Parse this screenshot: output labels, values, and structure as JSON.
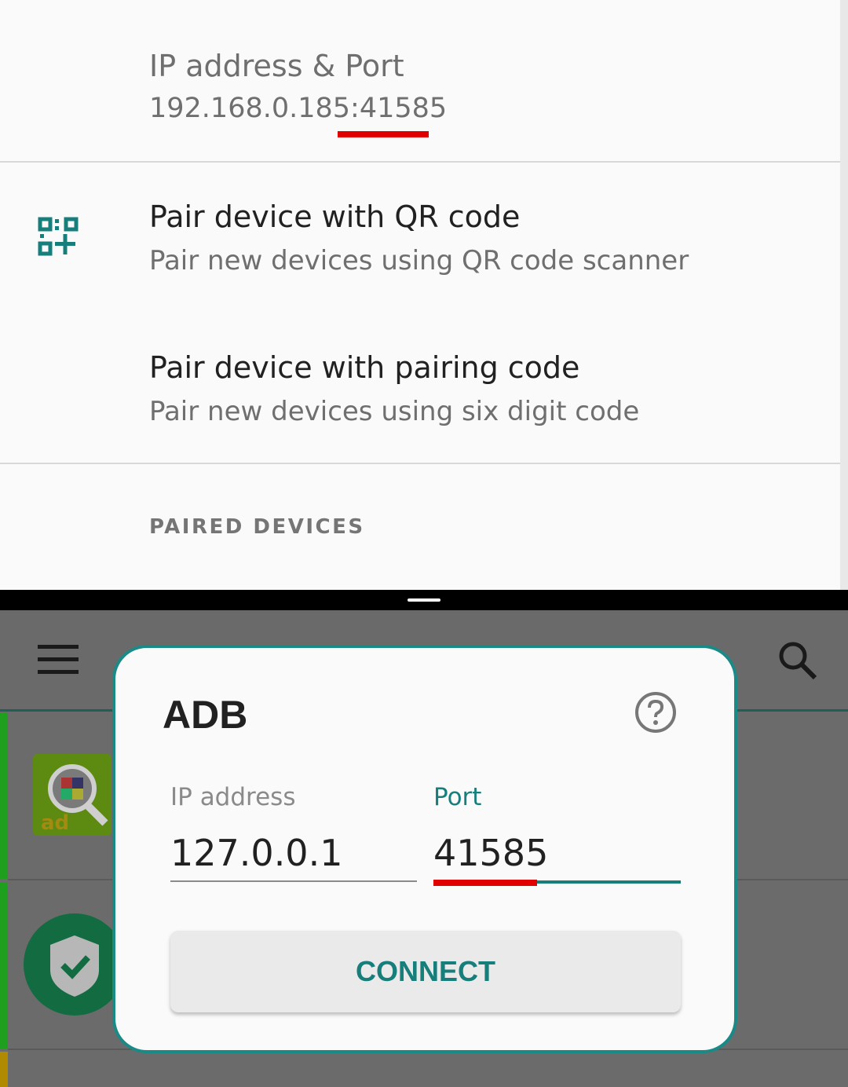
{
  "settings": {
    "ip_port_title": "IP address & Port",
    "ip_port_value": "192.168.0.185:41585",
    "pair_qr_title": "Pair device with QR code",
    "pair_qr_sub": "Pair new devices using QR code scanner",
    "pair_code_title": "Pair device with pairing code",
    "pair_code_sub": "Pair new devices using six digit code",
    "paired_header": "PAIRED DEVICES"
  },
  "app": {
    "menu_icon": "hamburger-menu-icon",
    "search_icon": "search-icon",
    "app1_text": "ad"
  },
  "dialog": {
    "title": "ADB",
    "help_icon": "help-circle-icon",
    "ip_label": "IP address",
    "ip_value": "127.0.0.1",
    "port_label": "Port",
    "port_value": "41585",
    "connect_label": "CONNECT"
  },
  "colors": {
    "accent": "#167f7b",
    "highlight_red": "#e00000",
    "list_green": "#1ea01e"
  }
}
